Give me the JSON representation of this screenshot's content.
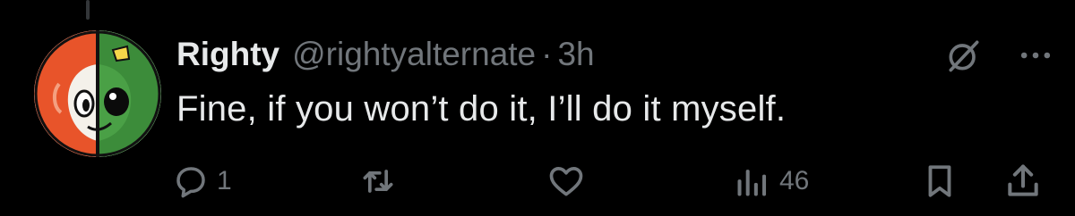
{
  "post": {
    "author": {
      "display_name": "Righty",
      "handle": "@rightyalternate",
      "separator": "·",
      "time": "3h",
      "avatar_icon": "split-face-avatar-icon"
    },
    "text": "Fine, if you won’t do it, I’ll do it myself.",
    "top_actions": {
      "grok_icon": "grok-icon",
      "more_icon": "more-options-icon"
    },
    "actions": {
      "reply": {
        "icon": "reply-icon",
        "count": "1"
      },
      "repost": {
        "icon": "repost-icon",
        "count": ""
      },
      "like": {
        "icon": "like-icon",
        "count": ""
      },
      "views": {
        "icon": "views-icon",
        "count": "46"
      },
      "bookmark": {
        "icon": "bookmark-icon"
      },
      "share": {
        "icon": "share-icon"
      }
    }
  },
  "colors": {
    "background": "#000000",
    "primary_text": "#e7e9ea",
    "secondary_text": "#71767b",
    "avatar_orange": "#e8542a",
    "avatar_green": "#3c8c3a"
  }
}
